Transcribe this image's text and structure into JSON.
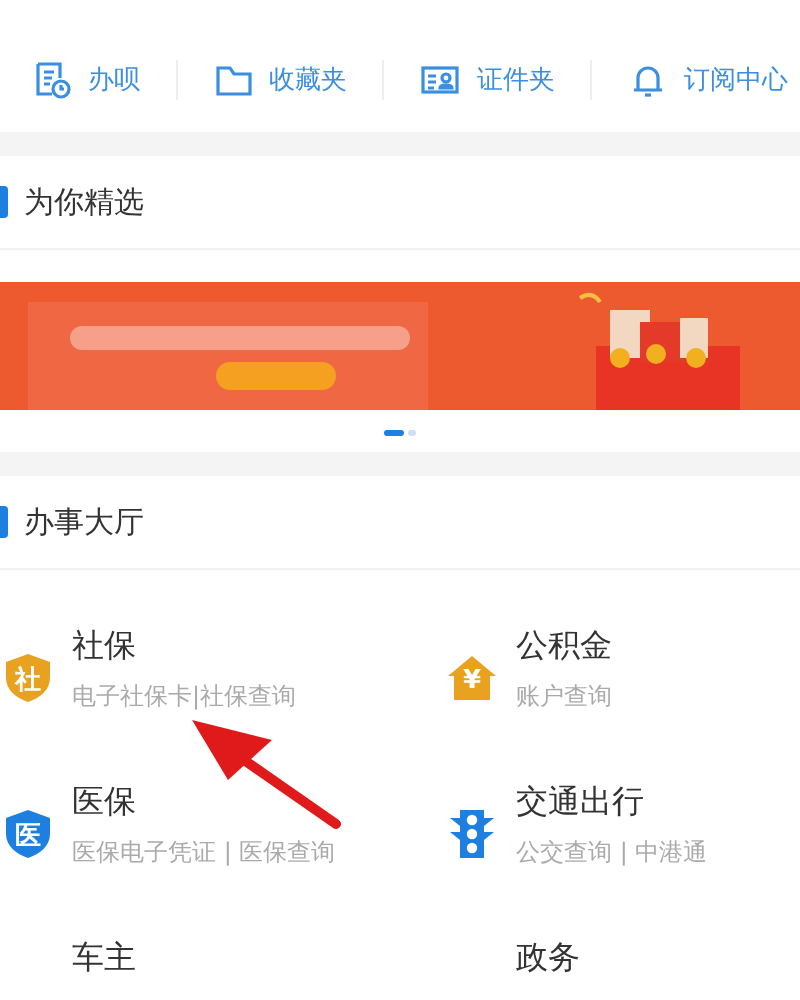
{
  "shortcuts": [
    {
      "kind": "doc-clock",
      "label": "办呗"
    },
    {
      "kind": "folder",
      "label": "收藏夹"
    },
    {
      "kind": "id-card",
      "label": "证件夹"
    },
    {
      "kind": "bell",
      "label": "订阅中心"
    }
  ],
  "featured": {
    "title": "为你精选",
    "pager": [
      {
        "selected": true
      },
      {
        "selected": false
      }
    ]
  },
  "hall": {
    "title": "办事大厅",
    "services": [
      {
        "kind": "shield",
        "color": "#e8a21f",
        "icon_text": "社",
        "title": "社保",
        "subtitle": "电子社保卡|社保查询"
      },
      {
        "kind": "house",
        "color": "#e8a21f",
        "icon_text": "¥",
        "title": "公积金",
        "subtitle": "账户查询"
      },
      {
        "kind": "shield",
        "color": "#1d7fe0",
        "icon_text": "医",
        "title": "医保",
        "subtitle": "医保电子凭证 | 医保查询"
      },
      {
        "kind": "traffic-light",
        "color": "#1d7fe0",
        "title": "交通出行",
        "subtitle": "公交查询 | 中港通"
      },
      {
        "title": "车主"
      },
      {
        "title": "政务"
      }
    ]
  },
  "annotation": {
    "kind": "arrow"
  }
}
